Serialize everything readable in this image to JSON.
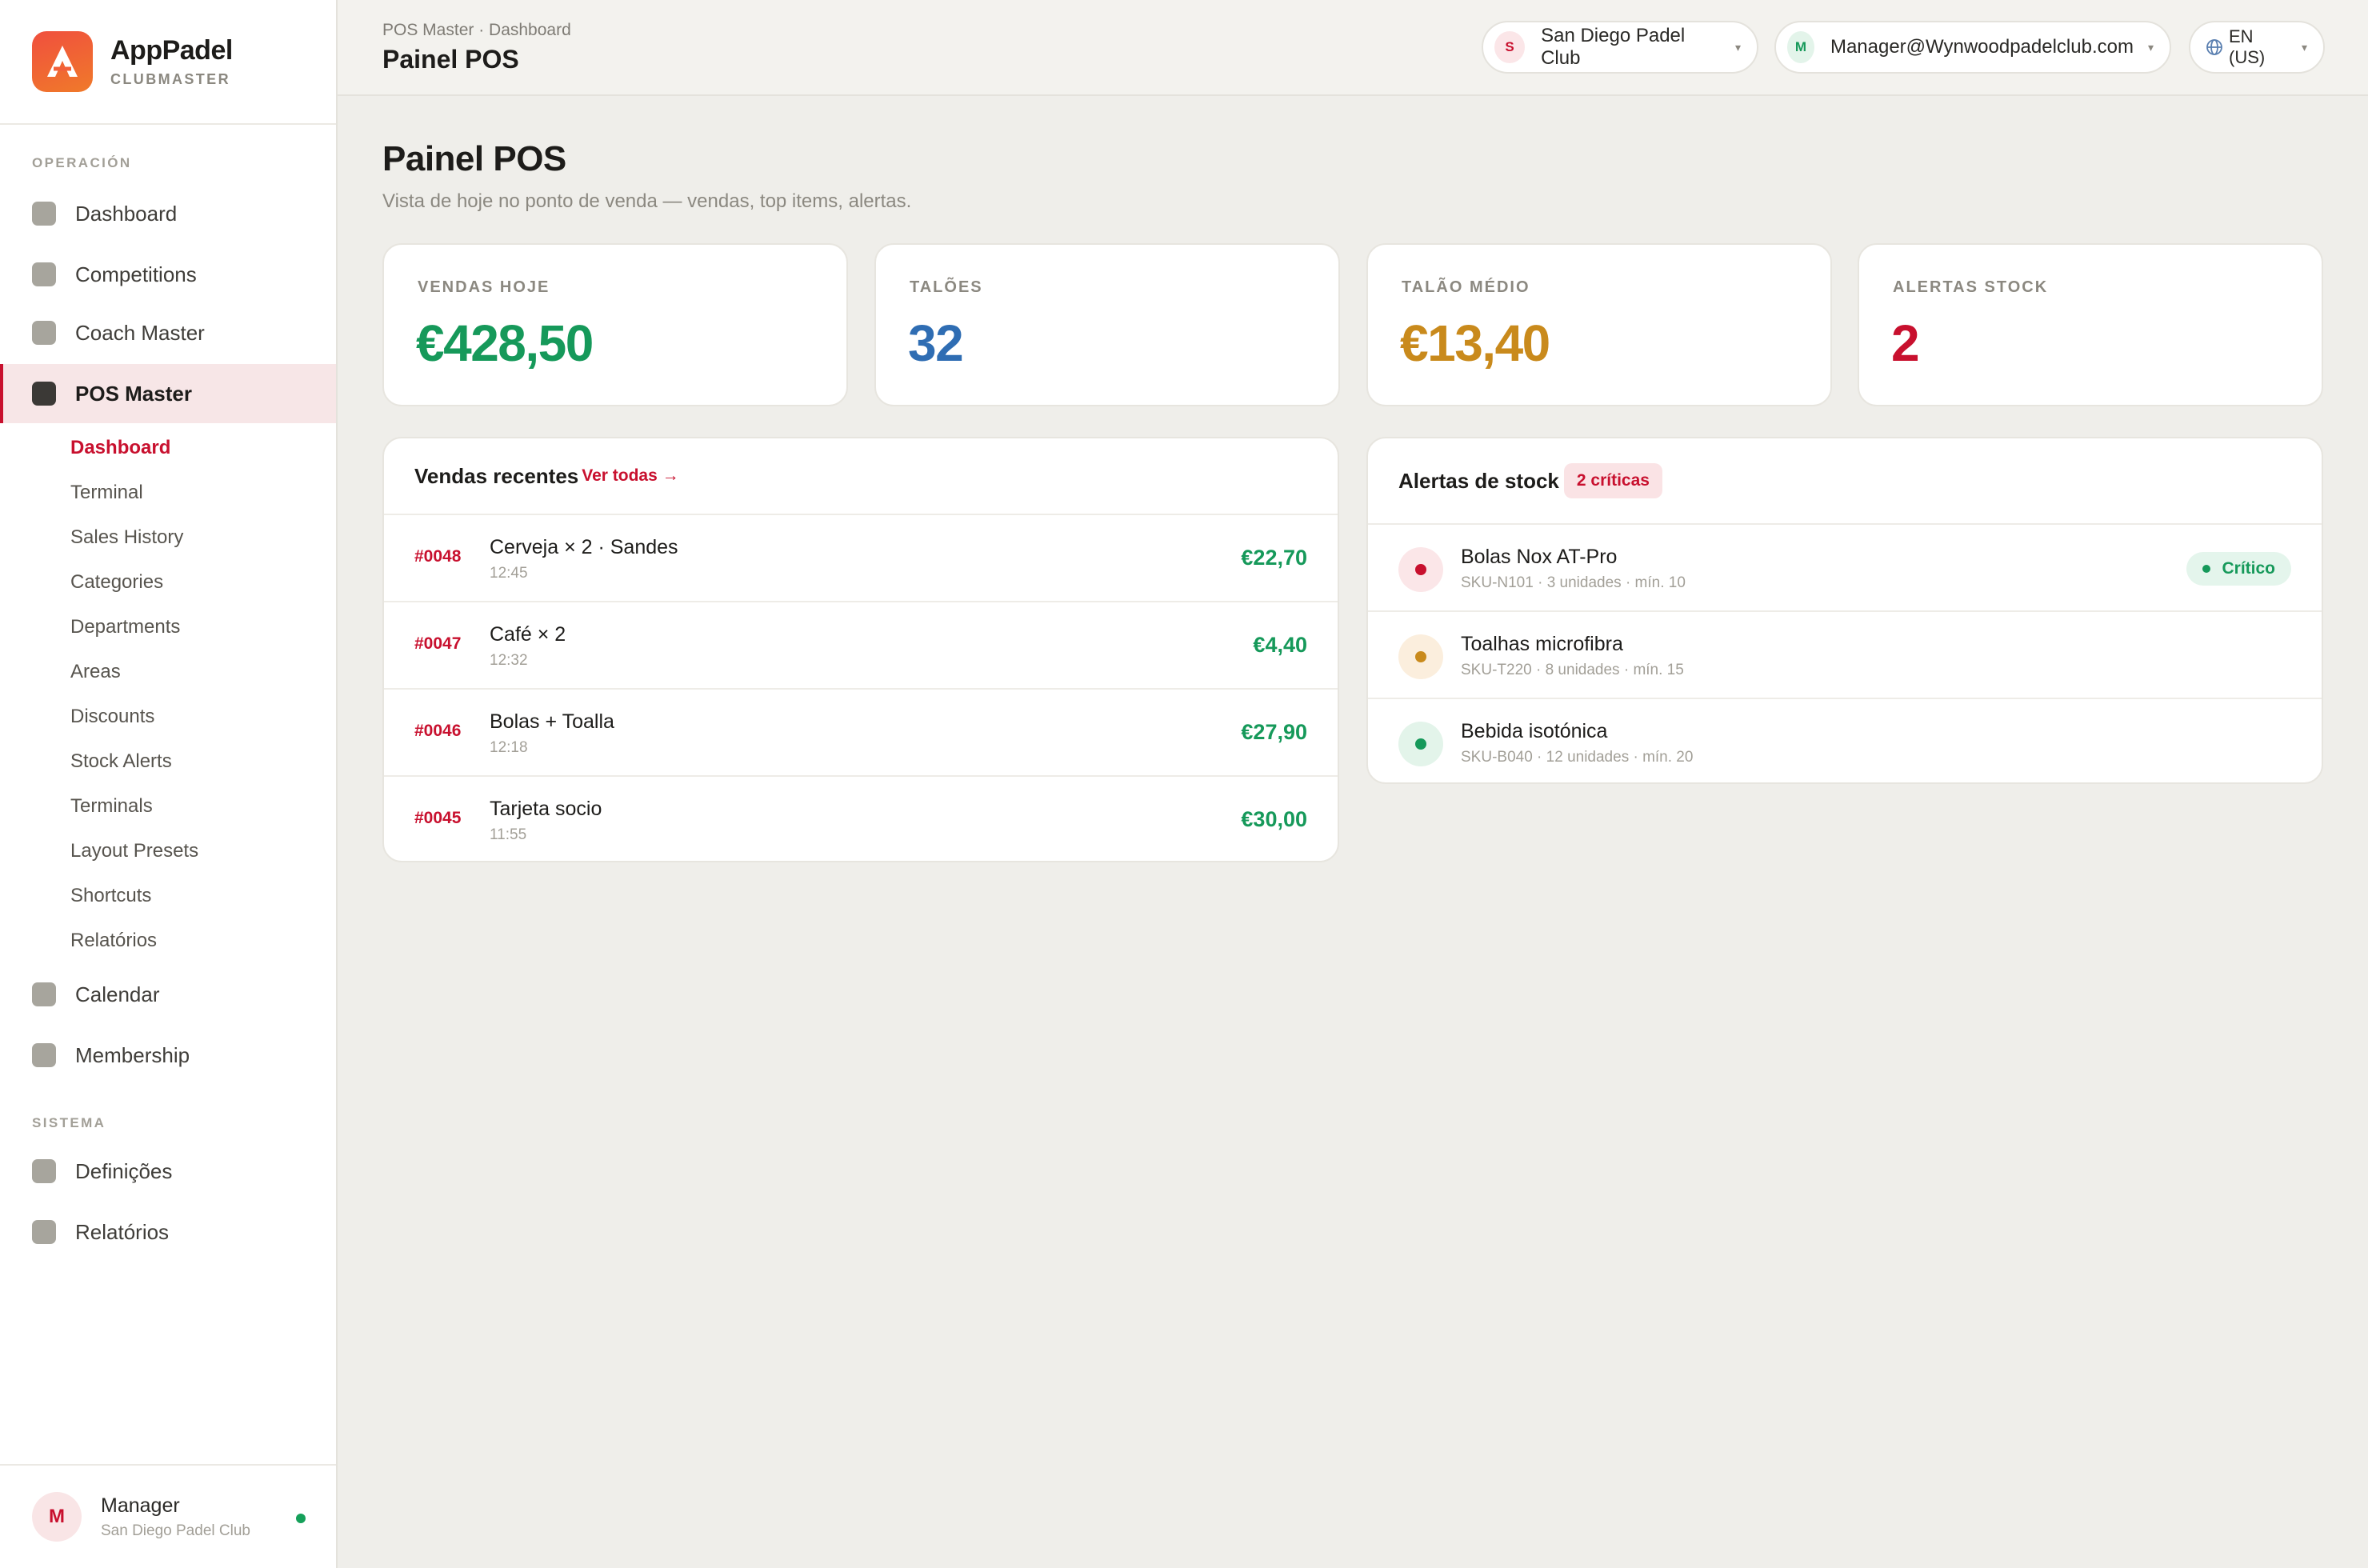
{
  "brand": {
    "name": "AppPadel",
    "sub": "CLUBMASTER"
  },
  "sidebar": {
    "section_operacion": "OPERACIÓN",
    "section_sistema": "SISTEMA",
    "items": [
      {
        "label": "Dashboard"
      },
      {
        "label": "Competitions"
      },
      {
        "label": "Coach Master"
      },
      {
        "label": "POS Master"
      },
      {
        "label": "Calendar"
      },
      {
        "label": "Membership"
      },
      {
        "label": "Definições"
      },
      {
        "label": "Relatórios"
      }
    ],
    "pos_sub": [
      "Dashboard",
      "Terminal",
      "Sales History",
      "Categories",
      "Departments",
      "Areas",
      "Discounts",
      "Stock Alerts",
      "Terminals",
      "Layout Presets",
      "Shortcuts",
      "Relatórios"
    ],
    "user": {
      "initial": "M",
      "name": "Manager",
      "club": "San Diego Padel Club"
    }
  },
  "topbar": {
    "breadcrumb": "POS Master · Dashboard",
    "title": "Painel POS",
    "club": {
      "initial": "S",
      "name": "San Diego Padel Club"
    },
    "account": {
      "initial": "M",
      "email": "Manager@Wynwoodpadelclub.com"
    },
    "language": "EN (US)"
  },
  "page": {
    "title": "Painel POS",
    "subtitle": "Vista de hoje no ponto de venda — vendas, top items, alertas."
  },
  "kpis": [
    {
      "label": "VENDAS HOJE",
      "value": "€428,50",
      "color": "#16995a"
    },
    {
      "label": "TALÕES",
      "value": "32",
      "color": "#2f6db3"
    },
    {
      "label": "TALÃO MÉDIO",
      "value": "€13,40",
      "color": "#c98a1c"
    },
    {
      "label": "ALERTAS STOCK",
      "value": "2",
      "color": "#c8102e"
    }
  ],
  "recent_sales": {
    "title": "Vendas recentes",
    "link": "Ver todas →",
    "rows": [
      {
        "id": "#0048",
        "name": "Cerveja × 2 · Sandes",
        "time": "12:45",
        "amount": "€22,70"
      },
      {
        "id": "#0047",
        "name": "Café × 2",
        "time": "12:32",
        "amount": "€4,40"
      },
      {
        "id": "#0046",
        "name": "Bolas + Toalla",
        "time": "12:18",
        "amount": "€27,90"
      },
      {
        "id": "#0045",
        "name": "Tarjeta socio",
        "time": "11:55",
        "amount": "€30,00"
      }
    ]
  },
  "stock_alerts": {
    "title": "Alertas de stock",
    "badge": "2 críticas",
    "rows": [
      {
        "name": "Bolas Nox AT-Pro",
        "meta": "SKU-N101 · 3 unidades · mín. 10",
        "dot": "#c8102e",
        "bg": "#fbe6e8",
        "status": "Crítico"
      },
      {
        "name": "Toalhas microfibra",
        "meta": "SKU-T220 · 8 unidades · mín. 15",
        "dot": "#c98a1c",
        "bg": "#fbeedd",
        "status": ""
      },
      {
        "name": "Bebida isotónica",
        "meta": "SKU-B040 · 12 unidades · mín. 20",
        "dot": "#16995a",
        "bg": "#e3f4ea",
        "status": ""
      }
    ]
  }
}
